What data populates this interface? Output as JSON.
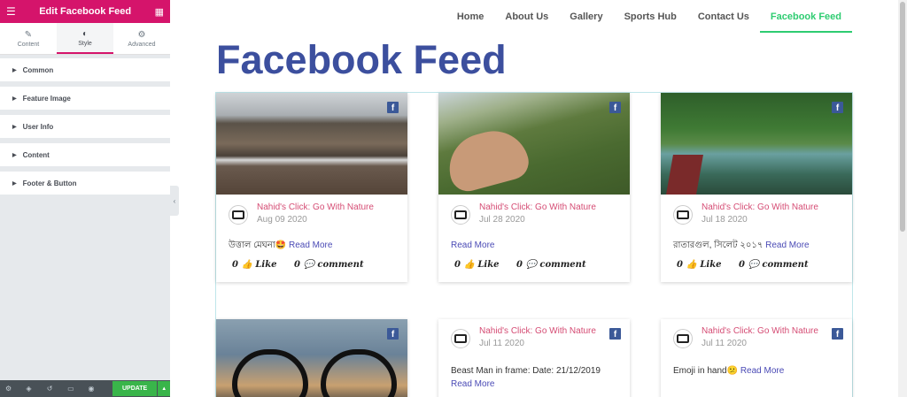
{
  "panel": {
    "title": "Edit Facebook Feed",
    "tabs": [
      {
        "label": "Content",
        "icon": "pencil-icon"
      },
      {
        "label": "Style",
        "icon": "contrast-icon"
      },
      {
        "label": "Advanced",
        "icon": "gear-icon"
      }
    ],
    "sections": [
      "Common",
      "Feature Image",
      "User Info",
      "Content",
      "Footer & Button"
    ],
    "update_label": "UPDATE"
  },
  "nav": [
    "Home",
    "About Us",
    "Gallery",
    "Sports Hub",
    "Contact Us",
    "Facebook Feed"
  ],
  "page_title": "Facebook Feed",
  "posts": [
    {
      "author": "Nahid's Click: Go With Nature",
      "date": "Aug 09 2020",
      "text": "উত্তাল মেঘনা🤩",
      "read_more": "Read More",
      "likes": "0",
      "like_label": "Like",
      "comments": "0",
      "comment_label": "comment"
    },
    {
      "author": "Nahid's Click: Go With Nature",
      "date": "Jul 28 2020",
      "text": "",
      "read_more": "Read More",
      "likes": "0",
      "like_label": "Like",
      "comments": "0",
      "comment_label": "comment"
    },
    {
      "author": "Nahid's Click: Go With Nature",
      "date": "Jul 18 2020",
      "text": "রাতারগুল, সিলেট ২০১৭",
      "read_more": "Read More",
      "likes": "0",
      "like_label": "Like",
      "comments": "0",
      "comment_label": "comment"
    },
    {
      "author": "Nahid's Click: Go With Nature",
      "date": "Jul 11 2020",
      "text": "Beast Man in frame: Date: 21/12/2019",
      "read_more": "Read More"
    },
    {
      "author": "Nahid's Click: Go With Nature",
      "date": "Jul 11 2020",
      "text": "Emoji in hand😕",
      "read_more": "Read More"
    }
  ],
  "colors": {
    "brand": "#d5146b",
    "title": "#3c4f9e",
    "active_nav": "#2ecc71",
    "author": "#d54c74",
    "facebook": "#3b5998"
  }
}
